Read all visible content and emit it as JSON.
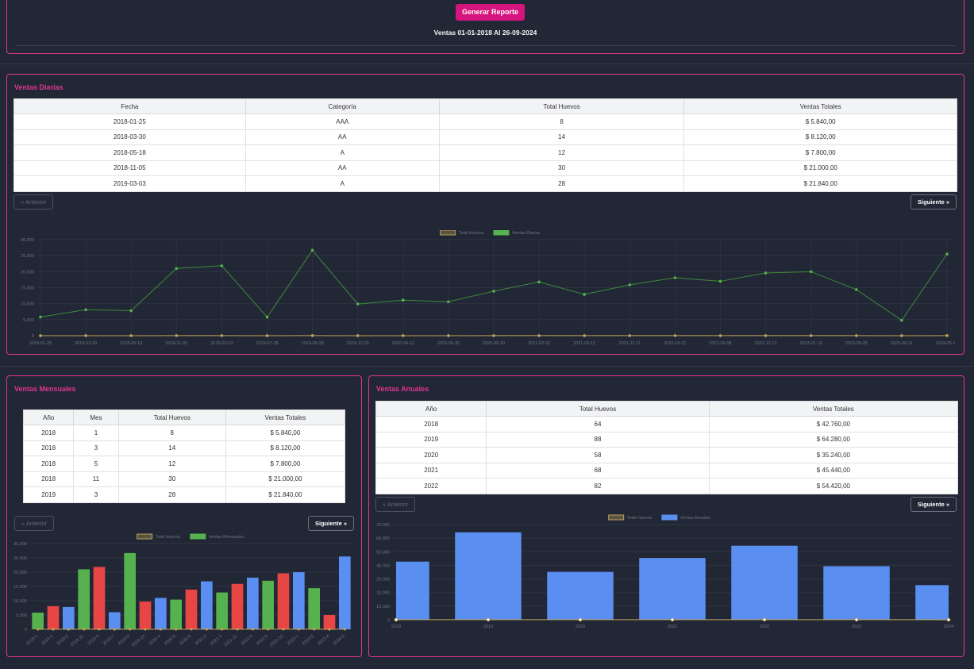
{
  "header": {
    "generate_label": "Generar Reporte",
    "range_text": "Ventas 01-01-2018 Al 26-09-2024"
  },
  "colors": {
    "accent": "#e0358f",
    "button": "#d6147d",
    "eggs": "#bfa15a",
    "green": "#55b24e",
    "red": "#e84545",
    "blue": "#5a8ef0"
  },
  "daily": {
    "title": "Ventas Diarias",
    "columns": [
      "Fecha",
      "Categoría",
      "Total Huevos",
      "Ventas Totales"
    ],
    "rows": [
      [
        "2018-01-25",
        "AAA",
        "8",
        "$ 5.840,00"
      ],
      [
        "2018-03-30",
        "AA",
        "14",
        "$ 8.120,00"
      ],
      [
        "2018-05-18",
        "A",
        "12",
        "$ 7.800,00"
      ],
      [
        "2018-11-05",
        "AA",
        "30",
        "$ 21.000,00"
      ],
      [
        "2019-03-03",
        "A",
        "28",
        "$ 21.840,00"
      ]
    ],
    "prev_label": "« Anterior",
    "next_label": "Siguiente »"
  },
  "monthly": {
    "title": "Ventas Mensuales",
    "columns": [
      "Año",
      "Mes",
      "Total Huevos",
      "Ventas Totales"
    ],
    "rows": [
      [
        "2018",
        "1",
        "8",
        "$ 5.840,00"
      ],
      [
        "2018",
        "3",
        "14",
        "$ 8.120,00"
      ],
      [
        "2018",
        "5",
        "12",
        "$ 7.800,00"
      ],
      [
        "2018",
        "11",
        "30",
        "$ 21.000,00"
      ],
      [
        "2019",
        "3",
        "28",
        "$ 21.840,00"
      ]
    ],
    "prev_label": "« Anterior",
    "next_label": "Siguiente »"
  },
  "annual": {
    "title": "Ventas Anuales",
    "columns": [
      "Año",
      "Total Huevos",
      "Ventas Totales"
    ],
    "rows": [
      [
        "2018",
        "64",
        "$ 42.760,00"
      ],
      [
        "2019",
        "88",
        "$ 64.280,00"
      ],
      [
        "2020",
        "58",
        "$ 35.240,00"
      ],
      [
        "2021",
        "68",
        "$ 45.440,00"
      ],
      [
        "2022",
        "82",
        "$ 54.420,00"
      ]
    ],
    "prev_label": "« Anterior",
    "next_label": "Siguiente »"
  },
  "chart_data": [
    {
      "type": "line",
      "legend": "top",
      "grid": true,
      "ylim": [
        0,
        30000
      ],
      "yticks": [
        "0",
        "5.000",
        "10.000",
        "15.000",
        "20.000",
        "25.000",
        "30.000"
      ],
      "categories": [
        "2018-01-25",
        "2018-03-30",
        "2018-05-18",
        "2018-11-05",
        "2019-03-03",
        "2019-07-28",
        "2019-09-18",
        "2019-12-28",
        "2020-04-12",
        "2020-06-30",
        "2020-09-20",
        "2021-02-02",
        "2021-03-15",
        "2021-11-11",
        "2022-06-22",
        "2022-09-08",
        "2022-12-12",
        "2023-01-10",
        "2023-05-05",
        "2023-08-21",
        "2024-05-26"
      ],
      "series": [
        {
          "name": "Total Huevos",
          "values": [
            8,
            14,
            12,
            30,
            28,
            8,
            36,
            13,
            15,
            14,
            19,
            23,
            17,
            22,
            25,
            23,
            27,
            28,
            20,
            6,
            35
          ]
        },
        {
          "name": "Ventas Diarias",
          "values": [
            5840,
            8120,
            7800,
            21000,
            21840,
            5800,
            26700,
            9900,
            11100,
            10600,
            13900,
            16800,
            12900,
            15900,
            18100,
            17000,
            19600,
            20000,
            14400,
            4800,
            25500
          ]
        }
      ]
    },
    {
      "type": "bar",
      "legend": "top",
      "grid": true,
      "ylim": [
        0,
        30000
      ],
      "yticks": [
        "0",
        "5.000",
        "10.000",
        "15.000",
        "20.000",
        "25.000",
        "30.000"
      ],
      "categories": [
        "2018-1",
        "2018-3",
        "2018-5",
        "2018-11",
        "2019-3",
        "2019-7",
        "2019-9",
        "2019-12",
        "2020-4",
        "2020-6",
        "2020-9",
        "2021-2",
        "2021-3",
        "2021-11",
        "2022-6",
        "2022-9",
        "2022-12",
        "2023-1",
        "2023-5",
        "2023-8",
        "2024-5"
      ],
      "series": [
        {
          "name": "Total Huevos",
          "values": [
            8,
            14,
            12,
            30,
            28,
            8,
            36,
            13,
            15,
            14,
            19,
            23,
            17,
            22,
            25,
            23,
            27,
            28,
            20,
            6,
            35
          ]
        },
        {
          "name": "Ventas Mensuales",
          "values": [
            5840,
            8120,
            7800,
            21000,
            21840,
            6000,
            26700,
            9700,
            11000,
            10400,
            13900,
            16800,
            12900,
            15900,
            18100,
            17000,
            19600,
            20000,
            14400,
            5000,
            25500
          ]
        }
      ]
    },
    {
      "type": "bar",
      "legend": "top",
      "grid": true,
      "ylim": [
        0,
        70000
      ],
      "yticks": [
        "0",
        "10.000",
        "20.000",
        "30.000",
        "40.000",
        "50.000",
        "60.000",
        "70.000"
      ],
      "categories": [
        "2018",
        "2019",
        "2020",
        "2021",
        "2022",
        "2023",
        "2024"
      ],
      "series": [
        {
          "name": "Total Huevos",
          "values": [
            64,
            88,
            58,
            68,
            82,
            72,
            35
          ]
        },
        {
          "name": "Ventas Anuales",
          "values": [
            42760,
            64280,
            35240,
            45440,
            54420,
            39400,
            25500
          ]
        }
      ]
    }
  ]
}
